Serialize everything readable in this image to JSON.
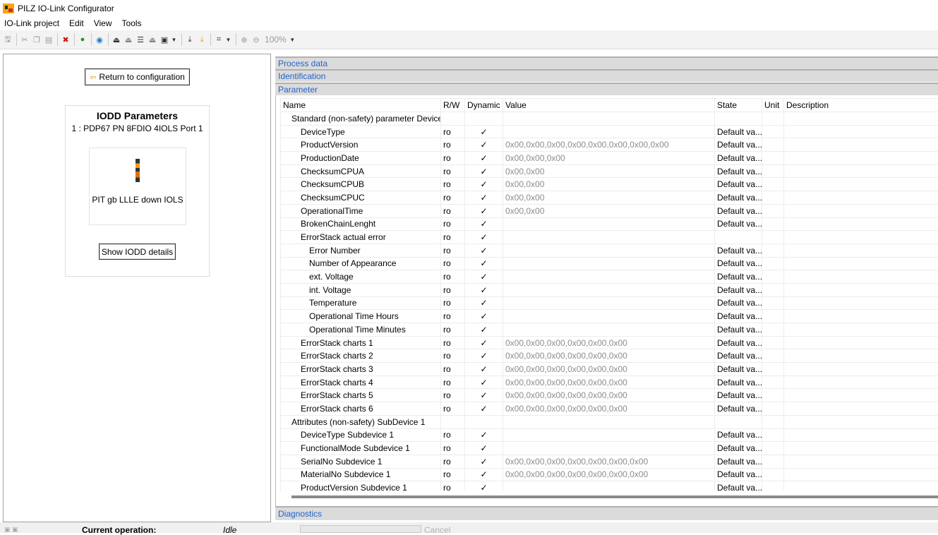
{
  "window": {
    "title": "PILZ IO-Link Configurator"
  },
  "menu": [
    "IO-Link project",
    "Edit",
    "View",
    "Tools"
  ],
  "toolbar": {
    "zoom": "100%"
  },
  "left_panel": {
    "return_label": "Return to configuration",
    "iodd_title": "IODD Parameters",
    "iodd_subtitle": "1 : PDP67 PN 8FDIO 4IOLS Port 1",
    "device_name": "PIT gb LLLE down IOLS",
    "show_details_label": "Show IODD details"
  },
  "sections": {
    "process_data": "Process data",
    "identification": "Identification",
    "parameter": "Parameter",
    "diagnostics": "Diagnostics"
  },
  "param_table": {
    "columns": [
      "Name",
      "R/W",
      "Dynamic",
      "Value",
      "State",
      "Unit",
      "Description"
    ],
    "rows": [
      {
        "name": "Standard (non-safety) parameter Device",
        "level": 0,
        "rw": "",
        "dyn": "",
        "value": "",
        "state": "",
        "unit": "",
        "desc": ""
      },
      {
        "name": "DeviceType",
        "level": 1,
        "rw": "ro",
        "dyn": "✓",
        "value": "",
        "state": "Default va...",
        "unit": "",
        "desc": ""
      },
      {
        "name": "ProductVersion",
        "level": 1,
        "rw": "ro",
        "dyn": "✓",
        "value": "0x00,0x00,0x00,0x00,0x00,0x00,0x00,0x00",
        "state": "Default va...",
        "unit": "",
        "desc": ""
      },
      {
        "name": "ProductionDate",
        "level": 1,
        "rw": "ro",
        "dyn": "✓",
        "value": "0x00,0x00,0x00",
        "state": "Default va...",
        "unit": "",
        "desc": ""
      },
      {
        "name": "ChecksumCPUA",
        "level": 1,
        "rw": "ro",
        "dyn": "✓",
        "value": "0x00,0x00",
        "state": "Default va...",
        "unit": "",
        "desc": ""
      },
      {
        "name": "ChecksumCPUB",
        "level": 1,
        "rw": "ro",
        "dyn": "✓",
        "value": "0x00,0x00",
        "state": "Default va...",
        "unit": "",
        "desc": ""
      },
      {
        "name": "ChecksumCPUC",
        "level": 1,
        "rw": "ro",
        "dyn": "✓",
        "value": "0x00,0x00",
        "state": "Default va...",
        "unit": "",
        "desc": ""
      },
      {
        "name": "OperationalTime",
        "level": 1,
        "rw": "ro",
        "dyn": "✓",
        "value": "0x00,0x00",
        "state": "Default va...",
        "unit": "",
        "desc": ""
      },
      {
        "name": "BrokenChainLenght",
        "level": 1,
        "rw": "ro",
        "dyn": "✓",
        "value": "",
        "state": "Default va...",
        "unit": "",
        "desc": ""
      },
      {
        "name": "ErrorStack actual error",
        "level": 1,
        "rw": "ro",
        "dyn": "✓",
        "value": "",
        "state": "",
        "unit": "",
        "desc": ""
      },
      {
        "name": "Error Number",
        "level": 2,
        "rw": "ro",
        "dyn": "✓",
        "value": "",
        "state": "Default va...",
        "unit": "",
        "desc": ""
      },
      {
        "name": "Number of Appearance",
        "level": 2,
        "rw": "ro",
        "dyn": "✓",
        "value": "",
        "state": "Default va...",
        "unit": "",
        "desc": ""
      },
      {
        "name": "ext. Voltage",
        "level": 2,
        "rw": "ro",
        "dyn": "✓",
        "value": "",
        "state": "Default va...",
        "unit": "",
        "desc": ""
      },
      {
        "name": "int. Voltage",
        "level": 2,
        "rw": "ro",
        "dyn": "✓",
        "value": "",
        "state": "Default va...",
        "unit": "",
        "desc": ""
      },
      {
        "name": "Temperature",
        "level": 2,
        "rw": "ro",
        "dyn": "✓",
        "value": "",
        "state": "Default va...",
        "unit": "",
        "desc": ""
      },
      {
        "name": "Operational Time Hours",
        "level": 2,
        "rw": "ro",
        "dyn": "✓",
        "value": "",
        "state": "Default va...",
        "unit": "",
        "desc": ""
      },
      {
        "name": "Operational Time Minutes",
        "level": 2,
        "rw": "ro",
        "dyn": "✓",
        "value": "",
        "state": "Default va...",
        "unit": "",
        "desc": ""
      },
      {
        "name": "ErrorStack charts 1",
        "level": 1,
        "rw": "ro",
        "dyn": "✓",
        "value": "0x00,0x00,0x00,0x00,0x00,0x00",
        "state": "Default va...",
        "unit": "",
        "desc": ""
      },
      {
        "name": "ErrorStack charts 2",
        "level": 1,
        "rw": "ro",
        "dyn": "✓",
        "value": "0x00,0x00,0x00,0x00,0x00,0x00",
        "state": "Default va...",
        "unit": "",
        "desc": ""
      },
      {
        "name": "ErrorStack charts 3",
        "level": 1,
        "rw": "ro",
        "dyn": "✓",
        "value": "0x00,0x00,0x00,0x00,0x00,0x00",
        "state": "Default va...",
        "unit": "",
        "desc": ""
      },
      {
        "name": "ErrorStack charts 4",
        "level": 1,
        "rw": "ro",
        "dyn": "✓",
        "value": "0x00,0x00,0x00,0x00,0x00,0x00",
        "state": "Default va...",
        "unit": "",
        "desc": ""
      },
      {
        "name": "ErrorStack charts 5",
        "level": 1,
        "rw": "ro",
        "dyn": "✓",
        "value": "0x00,0x00,0x00,0x00,0x00,0x00",
        "state": "Default va...",
        "unit": "",
        "desc": ""
      },
      {
        "name": "ErrorStack charts 6",
        "level": 1,
        "rw": "ro",
        "dyn": "✓",
        "value": "0x00,0x00,0x00,0x00,0x00,0x00",
        "state": "Default va...",
        "unit": "",
        "desc": ""
      },
      {
        "name": "Attributes (non-safety) SubDevice 1",
        "level": 0,
        "rw": "",
        "dyn": "",
        "value": "",
        "state": "",
        "unit": "",
        "desc": ""
      },
      {
        "name": "DeviceType Subdevice 1",
        "level": 1,
        "rw": "ro",
        "dyn": "✓",
        "value": "",
        "state": "Default va...",
        "unit": "",
        "desc": ""
      },
      {
        "name": "FunctionalMode Subdevice 1",
        "level": 1,
        "rw": "ro",
        "dyn": "✓",
        "value": "",
        "state": "Default va...",
        "unit": "",
        "desc": ""
      },
      {
        "name": "SerialNo Subdevice 1",
        "level": 1,
        "rw": "ro",
        "dyn": "✓",
        "value": "0x00,0x00,0x00,0x00,0x00,0x00,0x00",
        "state": "Default va...",
        "unit": "",
        "desc": ""
      },
      {
        "name": "MaterialNo Subdevice 1",
        "level": 1,
        "rw": "ro",
        "dyn": "✓",
        "value": "0x00,0x00,0x00,0x00,0x00,0x00,0x00",
        "state": "Default va...",
        "unit": "",
        "desc": ""
      },
      {
        "name": "ProductVersion Subdevice 1",
        "level": 1,
        "rw": "ro",
        "dyn": "✓",
        "value": "",
        "state": "Default va...",
        "unit": "",
        "desc": ""
      }
    ]
  },
  "status": {
    "label": "Current operation:",
    "value": "Idle",
    "cancel": "Cancel"
  },
  "colors": {
    "section_text": "#2563c9",
    "section_bg": "#dbdbdb",
    "value_text": "#8c8c8c"
  }
}
